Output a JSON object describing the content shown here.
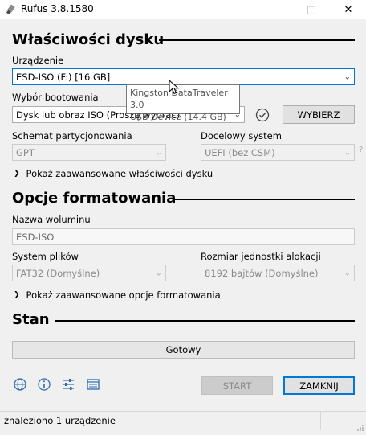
{
  "window": {
    "title": "Rufus 3.8.1580",
    "app_icon": "usb-drive-icon",
    "controls": [
      "minimize-icon",
      "maximize-icon",
      "close-icon"
    ]
  },
  "drive_properties": {
    "section_title": "Właściwości dysku",
    "device_label": "Urządzenie",
    "device_value": "ESD-ISO (F:) [16 GB]",
    "boot_label": "Wybór bootowania",
    "boot_value": "Dysk lub obraz ISO (Proszę wybrać)",
    "select_button": "WYBIERZ",
    "partition_label": "Schemat partycjonowania",
    "partition_value": "GPT",
    "target_label": "Docelowy system",
    "target_value": "UEFI (bez CSM)",
    "target_help": "?",
    "advanced_toggle": "Pokaż zaawansowane właściwości dysku"
  },
  "tooltip": {
    "line1": "Kingston DataTraveler 3.0",
    "line2": "USB Device (14.4 GB)"
  },
  "format_options": {
    "section_title": "Opcje formatowania",
    "volume_label": "Nazwa woluminu",
    "volume_value": "ESD-ISO",
    "fs_label": "System plików",
    "fs_value": "FAT32 (Domyślne)",
    "cluster_label": "Rozmiar jednostki alokacji",
    "cluster_value": "8192 bajtów (Domyślne)",
    "advanced_toggle": "Pokaż zaawansowane opcje formatowania"
  },
  "status": {
    "section_title": "Stan",
    "progress_text": "Gotowy",
    "progress_fraction": 0
  },
  "footer": {
    "icons": [
      "globe-icon",
      "info-icon",
      "settings-sliders-icon",
      "log-icon"
    ],
    "start_button": "START",
    "close_button": "ZAMKNIJ"
  },
  "statusbar": {
    "text": "znaleziono 1 urządzenie"
  },
  "colors": {
    "accent": "#0078d7",
    "background": "#f0f0f0"
  }
}
